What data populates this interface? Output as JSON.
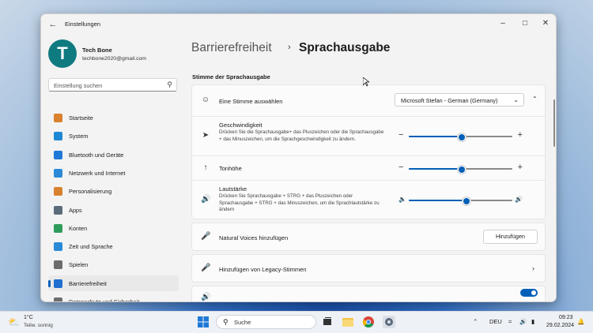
{
  "window": {
    "title": "Einstellungen"
  },
  "user": {
    "name": "Tech Bone",
    "email": "techbone2020@gmail.com",
    "initial": "T"
  },
  "search": {
    "placeholder": "Einstellung suchen"
  },
  "nav": [
    {
      "label": "Startseite",
      "icon": "home-icon",
      "color": "#d9812f"
    },
    {
      "label": "System",
      "icon": "system-icon",
      "color": "#1e88d6"
    },
    {
      "label": "Bluetooth und Geräte",
      "icon": "bluetooth-icon",
      "color": "#1e78d6"
    },
    {
      "label": "Netzwerk und Internet",
      "icon": "wifi-icon",
      "color": "#2a8ad8"
    },
    {
      "label": "Personalisierung",
      "icon": "brush-icon",
      "color": "#d9812f"
    },
    {
      "label": "Apps",
      "icon": "apps-icon",
      "color": "#5b6b7c"
    },
    {
      "label": "Konten",
      "icon": "accounts-icon",
      "color": "#2e9d5b"
    },
    {
      "label": "Zeit und Sprache",
      "icon": "globe-icon",
      "color": "#2a8ad8"
    },
    {
      "label": "Spielen",
      "icon": "gamepad-icon",
      "color": "#6d6d6d"
    },
    {
      "label": "Barrierefreiheit",
      "icon": "accessibility-icon",
      "color": "#1f6fd1"
    },
    {
      "label": "Datenschutz und Sicherheit",
      "icon": "shield-icon",
      "color": "#6d6d6d"
    }
  ],
  "breadcrumb": {
    "parent": "Barrierefreiheit",
    "current": "Sprachausgabe"
  },
  "section": {
    "title": "Stimme der Sprachausgabe"
  },
  "voice": {
    "label": "Eine Stimme auswählen",
    "selected": "Microsoft Stefan - German (Germany)"
  },
  "speed": {
    "label": "Geschwindigkeit",
    "desc": "Drücken Sie die Sprachausgabe+ das Pluszeichen oder die Sprachausgabe + das Minuszeichen, um die Sprachgeschwindigkeit zu ändern.",
    "level": 0.5
  },
  "pitch": {
    "label": "Tonhöhe",
    "level": 0.5
  },
  "volume": {
    "label": "Lautstärke",
    "desc": "Drücken Sie Sprachausgabe + STRG + das Pluszeichen oder Sprachausgabe + STRG + das Minuszeichen, um die Sprachlautstärke zu ändern",
    "level": 0.55
  },
  "natural": {
    "label": "Natural Voices hinzufügen",
    "button": "Hinzufügen"
  },
  "legacy": {
    "label": "Hinzufügen von Legacy-Stimmen"
  },
  "taskbar": {
    "temp": "1°C",
    "weather": "Teilw. sonnig",
    "search": "Suche",
    "lang": "DEU",
    "time": "09:23",
    "date": "29.02.2024"
  },
  "colors": {
    "accent": "#005fb8"
  }
}
